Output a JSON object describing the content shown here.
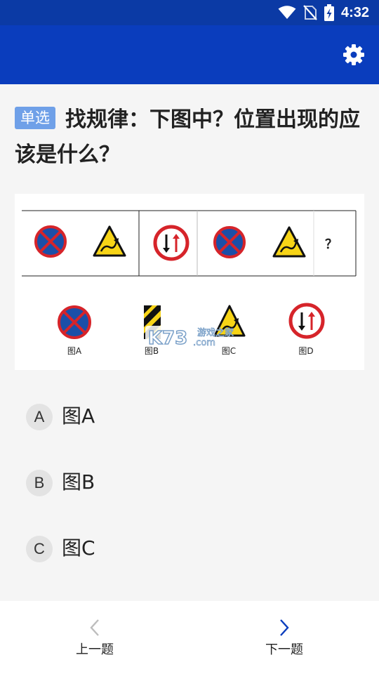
{
  "status_bar": {
    "time": "4:32"
  },
  "app_bar": {
    "settings_icon": "gear-icon"
  },
  "question": {
    "type_badge": "单选",
    "text": "找规律：下图中？位置出现的应该是什么？"
  },
  "figure": {
    "sequence_mark": "？",
    "watermark": "K73 游戏之家 .com",
    "candidates": [
      {
        "label": "图A",
        "sign": "no-parking"
      },
      {
        "label": "图B",
        "sign": "hazard-stripes"
      },
      {
        "label": "图C",
        "sign": "winding-road"
      },
      {
        "label": "图D",
        "sign": "two-way-priority"
      }
    ]
  },
  "options": [
    {
      "letter": "A",
      "text": "图A"
    },
    {
      "letter": "B",
      "text": "图B"
    },
    {
      "letter": "C",
      "text": "图C"
    }
  ],
  "nav": {
    "prev_label": "上一题",
    "next_label": "下一题",
    "prev_color": "#bdbdbd",
    "next_color": "#0a3dbd"
  }
}
